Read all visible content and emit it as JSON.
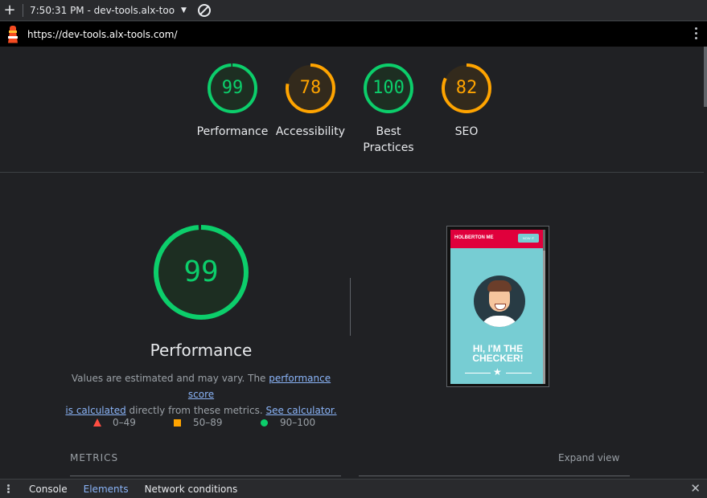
{
  "toolbar": {
    "report_label": "7:50:31 PM - dev-tools.alx-too"
  },
  "urlbar": {
    "url": "https://dev-tools.alx-tools.com/"
  },
  "gauges": [
    {
      "score": "99",
      "label": "Performance",
      "status": "pass",
      "fraction": 0.99
    },
    {
      "score": "78",
      "label": "Accessibility",
      "status": "average",
      "fraction": 0.78
    },
    {
      "score": "100",
      "label_line1": "Best",
      "label_line2": "Practices",
      "status": "pass",
      "fraction": 1.0
    },
    {
      "score": "82",
      "label": "SEO",
      "status": "average",
      "fraction": 0.82
    }
  ],
  "performance": {
    "score": "99",
    "fraction": 0.99,
    "title": "Performance",
    "desc_prefix": "Values are estimated and may vary. The ",
    "link_score_1": "performance score",
    "link_score_2": "is calculated",
    "desc_mid": " directly from these metrics. ",
    "link_calc": "See calculator.",
    "legend": {
      "fail": "0–49",
      "average": "50–89",
      "pass": "90–100"
    }
  },
  "thumbnail": {
    "brand": "HOLBERTON ME",
    "button": "NOW IT",
    "headline_1": "HI, I'M THE",
    "headline_2": "CHECKER!"
  },
  "metrics": {
    "label": "METRICS",
    "expand": "Expand view"
  },
  "drawer": {
    "tabs": [
      "Console",
      "Elements",
      "Network conditions"
    ],
    "active": "Elements"
  },
  "colors": {
    "pass": "#0cce6b",
    "average": "#ffa400",
    "fail": "#ff4e42",
    "link": "#8ab4f8"
  }
}
